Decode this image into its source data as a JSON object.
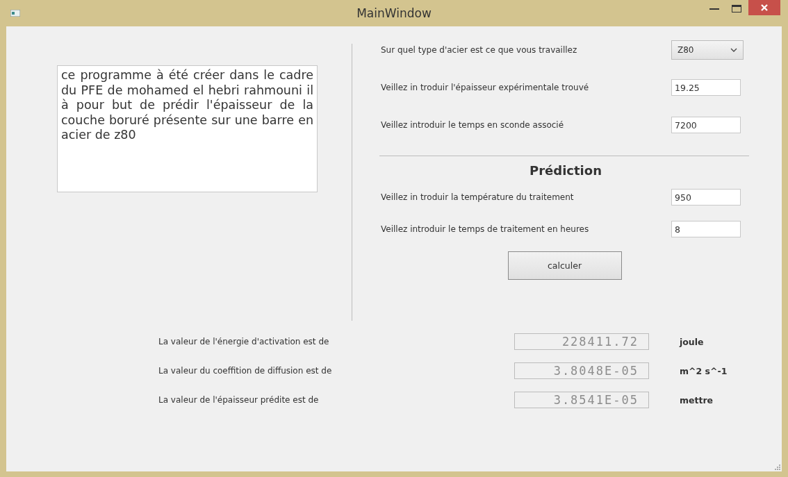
{
  "window": {
    "title": "MainWindow"
  },
  "description": "ce programme à été créer dans le cadre du PFE de mohamed el hebri rahmouni il à pour but de prédir l'épaisseur de la couche boruré présente sur une barre en acier de z80",
  "inputs": [
    {
      "kind": "combo",
      "label": "Sur quel type d'acier est ce que vous  travaillez",
      "value": "Z80"
    },
    {
      "kind": "field",
      "label": "Veillez in troduir l'épaisseur expérimentale trouvé",
      "value": "19.25"
    },
    {
      "kind": "field",
      "label": "Veillez introduir le temps en sconde associé",
      "value": "7200"
    }
  ],
  "prediction": {
    "heading": "Prédiction",
    "inputs": [
      {
        "kind": "field",
        "label": "Veillez in troduir la température du traitement",
        "value": "950"
      },
      {
        "kind": "field",
        "label": "Veillez introduir le temps de traitement en heures",
        "value": "8"
      }
    ],
    "button": "calculer"
  },
  "results": [
    {
      "label": "La valeur de l'énergie d'activation est de",
      "value": "228411.72",
      "unit": "joule"
    },
    {
      "label": "La valeur du coeffition de diffusion est de",
      "value": "3.8048E-05",
      "unit": "m^2 s^-1"
    },
    {
      "label": "La valeur de l'épaisseur prédite est de",
      "value": "3.8541E-05",
      "unit": "mettre"
    }
  ]
}
